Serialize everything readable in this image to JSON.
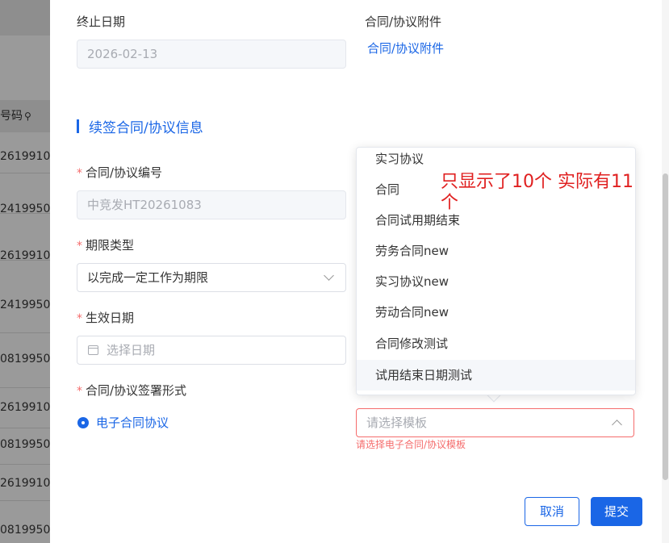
{
  "background": {
    "header_text": "号码",
    "rows": [
      "2619910",
      "2419950",
      "2619910",
      "2419950",
      "0819950",
      "2619910",
      "0819950",
      "2619910",
      "0819950"
    ]
  },
  "form": {
    "end_date": {
      "label": "终止日期",
      "value": "2026-02-13"
    },
    "attachment": {
      "label": "合同/协议附件",
      "link": "合同/协议附件"
    },
    "section_title": "续签合同/协议信息",
    "contract_no": {
      "label": "合同/协议编号",
      "value": "中竞发HT20261083"
    },
    "term_type": {
      "label": "期限类型",
      "value": "以完成一定工作为期限"
    },
    "effective_date": {
      "label": "生效日期",
      "placeholder": "选择日期"
    },
    "sign_form": {
      "label": "合同/协议签署形式",
      "radio_label": "电子合同协议"
    },
    "template": {
      "placeholder": "请选择模板",
      "error": "请选择电子合同/协议模板"
    }
  },
  "dropdown": {
    "options": [
      "实习协议",
      "合同",
      "合同试用期结束",
      "劳务合同new",
      "实习协议new",
      "劳动合同new",
      "合同修改测试",
      "试用结束日期测试"
    ],
    "hover_index": 7
  },
  "annotation": {
    "line1": "只显示了10个 实际有11",
    "line2": "个"
  },
  "buttons": {
    "cancel": "取消",
    "submit": "提交"
  },
  "colors": {
    "accent": "#1a66e6",
    "error": "#f56c6c",
    "annotation": "#e02020"
  }
}
